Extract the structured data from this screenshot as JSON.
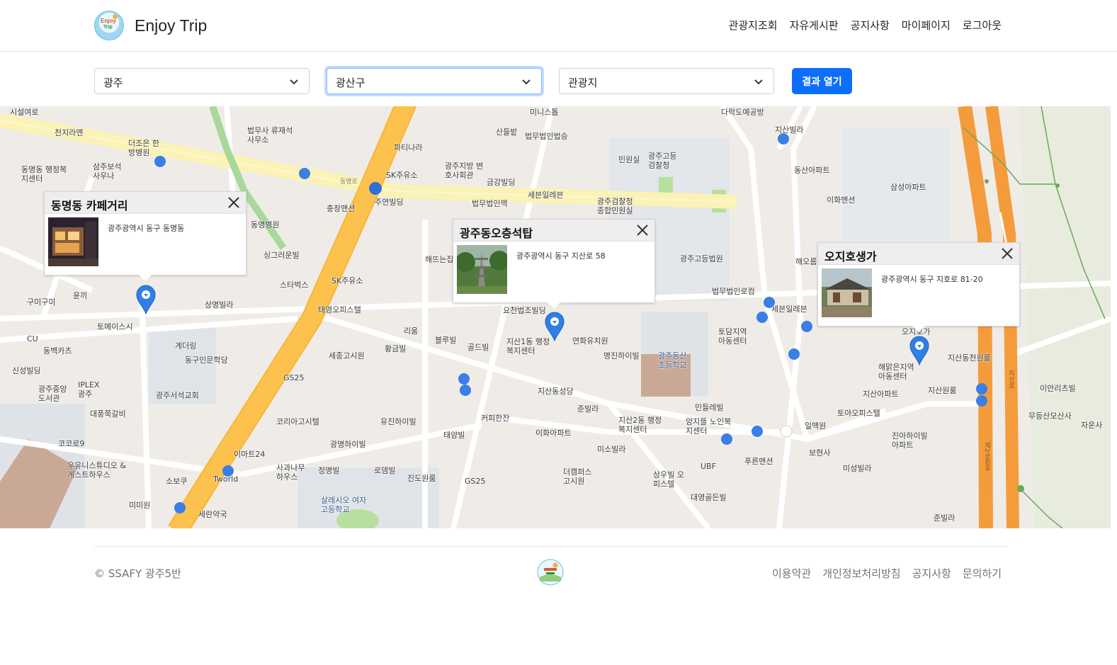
{
  "header": {
    "brand": "Enjoy Trip",
    "logo_text": [
      "Enjoy",
      "Trip"
    ],
    "nav": [
      "관광지조회",
      "자유게시판",
      "공지사항",
      "마이페이지",
      "로그아웃"
    ]
  },
  "filters": {
    "region": "광주",
    "district": "광산구",
    "content_type": "관광지",
    "submit_label": "결과 열기"
  },
  "map": {
    "info_windows": [
      {
        "title": "동명동 카페거리",
        "address": "광주광역시 동구 동명동"
      },
      {
        "title": "광주동오층석탑",
        "address": "광주광역시 동구 지산로 58"
      },
      {
        "title": "오지호생가",
        "address": "광주광역시 동구 지호로 81-20"
      }
    ],
    "labels": [
      "시설여로",
      "천지라멘",
      "더조은 한방병원",
      "삼주보석 사우나",
      "동명동 행정복지센터",
      "동명병원",
      "싱그러운빌",
      "스타벅스",
      "구미구미",
      "윤끼",
      "토메이스시",
      "CU",
      "동백카츠",
      "신성빌딩",
      "광주중앙 도서관",
      "IPLEX 광주",
      "대풍쭉갈비",
      "코코로9",
      "우유니스튜디오 &게스트하우스",
      "소보쿠",
      "미미원",
      "계더링",
      "동구인문학당",
      "광주서석교회",
      "상명빌라",
      "법무사 류재석사무소",
      "파티나라",
      "광주지방 변호사회관",
      "금강빌딩",
      "미니스톱",
      "산들밭",
      "법무법인법승",
      "세븐일레븐",
      "법무법인맥",
      "SK주유소",
      "동명로",
      "주연빌딩",
      "충장맨션",
      "SK주유소",
      "해뜨는집",
      "태영오피스텔",
      "리움",
      "블루빌",
      "골드빌",
      "황금빌",
      "세종고시원",
      "GS25",
      "코리아고시텔",
      "유진하이빌",
      "광명하이빌",
      "태양빌",
      "커피한잔",
      "이마트24",
      "사과나무 하우스",
      "정명빌",
      "로뎀빌",
      "진도원룸",
      "GS25",
      "Tworld",
      "세란약국",
      "살레시오 여자고등학교",
      "요천법조빌딩",
      "지산1동 행정복지센터",
      "연화유치원",
      "명진하이빌",
      "지산동성당",
      "준빌라",
      "이화아파트",
      "미소빌라",
      "더캠퍼스 고시원",
      "지산2동 행정복지센터",
      "광주동산 초등학교",
      "토담지역 아동센터",
      "민들레빌",
      "양지뜰 노인복지센터",
      "UBF",
      "상우빌 오피스텔",
      "대영골든빌",
      "푸른맨션",
      "민원실",
      "광주고등 검찰청",
      "광주검찰청 종합민원실",
      "광주고등법원",
      "법무법인로컴",
      "세븐일레븐",
      "다락도예공방",
      "지산빌라",
      "동산아파트",
      "이화맨션",
      "삼성아파트",
      "해오름",
      "해맑은지역 아동센터",
      "지산아파트",
      "토야오피스텔",
      "지산원룸",
      "지산동천원룸",
      "일맥원",
      "보현사",
      "미성빌라",
      "진아하이빌 아파트",
      "이안리츠빌",
      "무등산모산사",
      "자운사",
      "준빌라",
      "제2순환로",
      "지산로",
      "오지호가"
    ]
  },
  "footer": {
    "copyright": "© SSAFY 광주5반",
    "links": [
      "이용약관",
      "개인정보처리방침",
      "공지사항",
      "문의하기"
    ]
  },
  "colors": {
    "primary": "#0d6efd",
    "marker": "#2f7fe6",
    "arterial": "#fdc24e",
    "highway": "#f49c3c",
    "park": "#a8d89a"
  }
}
